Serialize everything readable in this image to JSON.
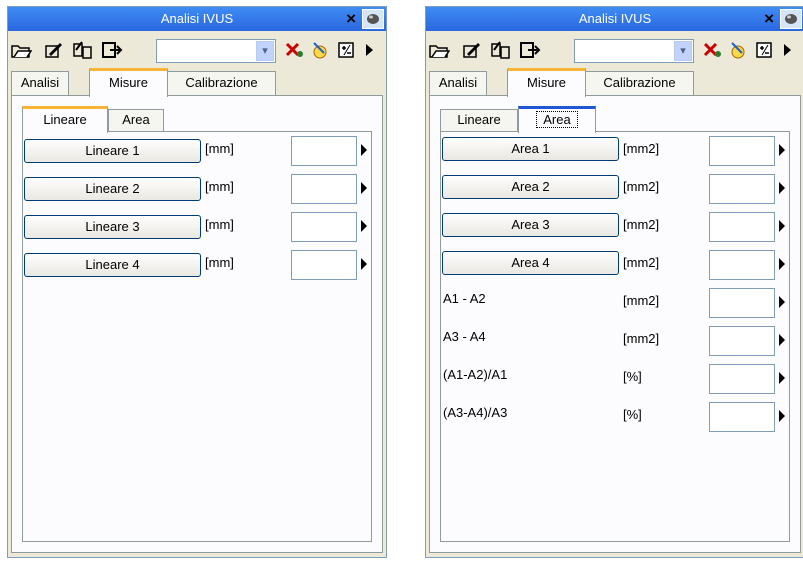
{
  "panels": [
    {
      "title": "Analisi IVUS",
      "close_glyph": "×",
      "toolbar": {
        "icons": [
          "open-folder-icon",
          "edit-curve-icon",
          "batch-edit-icon",
          "export-icon",
          "clear-measure-icon",
          "auto-detect-icon",
          "calculator-icon",
          "more-arrow-icon"
        ],
        "combo_value": ""
      },
      "tabs": [
        "Analisi",
        "Misure",
        "Calibrazione"
      ],
      "active_tab": "Misure",
      "subtabs": [
        "Lineare",
        "Area"
      ],
      "active_subtab": "Lineare",
      "rows": [
        {
          "label": "Lineare 1",
          "unit": "[mm]",
          "value": ""
        },
        {
          "label": "Lineare 2",
          "unit": "[mm]",
          "value": ""
        },
        {
          "label": "Lineare 3",
          "unit": "[mm]",
          "value": ""
        },
        {
          "label": "Lineare 4",
          "unit": "[mm]",
          "value": ""
        }
      ]
    },
    {
      "title": "Analisi IVUS",
      "close_glyph": "×",
      "toolbar": {
        "icons": [
          "open-folder-icon",
          "edit-curve-icon",
          "batch-edit-icon",
          "export-icon",
          "clear-measure-icon",
          "auto-detect-icon",
          "calculator-icon",
          "more-arrow-icon"
        ],
        "combo_value": ""
      },
      "tabs": [
        "Analisi",
        "Misure",
        "Calibrazione"
      ],
      "active_tab": "Misure",
      "subtabs": [
        "Lineare",
        "Area"
      ],
      "active_subtab": "Area",
      "button_rows": [
        {
          "label": "Area 1",
          "unit": "[mm2]",
          "value": ""
        },
        {
          "label": "Area 2",
          "unit": "[mm2]",
          "value": ""
        },
        {
          "label": "Area 3",
          "unit": "[mm2]",
          "value": ""
        },
        {
          "label": "Area 4",
          "unit": "[mm2]",
          "value": ""
        }
      ],
      "calc_rows": [
        {
          "label": "A1 - A2",
          "unit": "[mm2]",
          "value": ""
        },
        {
          "label": "A3 - A4",
          "unit": "[mm2]",
          "value": ""
        },
        {
          "label": "(A1-A2)/A1",
          "unit": "[%]",
          "value": ""
        },
        {
          "label": "(A3-A4)/A3",
          "unit": "[%]",
          "value": ""
        }
      ]
    }
  ]
}
